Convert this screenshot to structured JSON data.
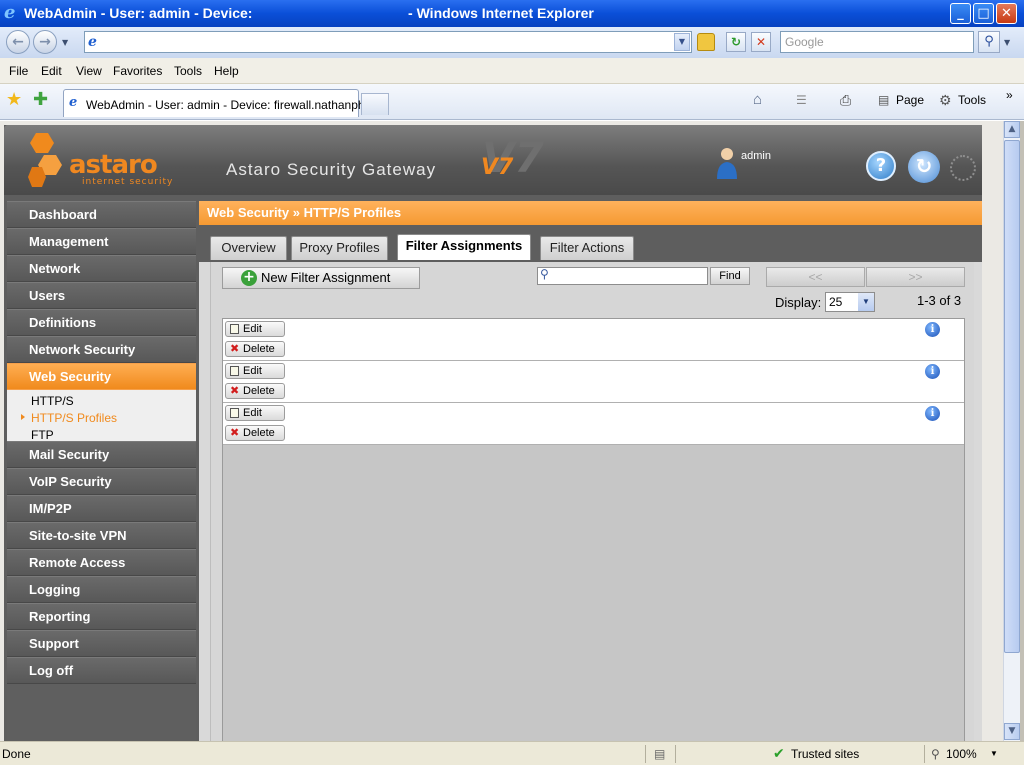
{
  "window": {
    "title": "WebAdmin - User: admin - Device:                                        - Windows Internet Explorer",
    "minimize": "_",
    "maximize": "□",
    "close": "✕"
  },
  "addressbar": {
    "url": "",
    "search_placeholder": "Google"
  },
  "menu": [
    "File",
    "Edit",
    "View",
    "Favorites",
    "Tools",
    "Help"
  ],
  "browser_tabs": {
    "active_tab": "WebAdmin - User: admin - Device: firewall.nathanpha...",
    "commands": {
      "page": "Page",
      "tools": "Tools"
    }
  },
  "header": {
    "logo_text": "astaro",
    "logo_sub": "internet security",
    "product": "Astaro Security Gateway",
    "version": "V7",
    "user": "admin"
  },
  "sidebar": {
    "items": [
      {
        "label": "Dashboard"
      },
      {
        "label": "Management"
      },
      {
        "label": "Network"
      },
      {
        "label": "Users"
      },
      {
        "label": "Definitions"
      },
      {
        "label": "Network Security"
      },
      {
        "label": "Web Security"
      },
      {
        "label": "Mail Security"
      },
      {
        "label": "VoIP Security"
      },
      {
        "label": "IM/P2P"
      },
      {
        "label": "Site-to-site VPN"
      },
      {
        "label": "Remote Access"
      },
      {
        "label": "Logging"
      },
      {
        "label": "Reporting"
      },
      {
        "label": "Support"
      },
      {
        "label": "Log off"
      }
    ],
    "active": "Web Security",
    "subitems": [
      "HTTP/S",
      "HTTP/S Profiles",
      "FTP"
    ],
    "active_subitem": "HTTP/S Profiles"
  },
  "main": {
    "breadcrumb": "Web Security » HTTP/S Profiles",
    "tabs": [
      "Overview",
      "Proxy Profiles",
      "Filter Assignments",
      "Filter Actions"
    ],
    "active_tab": "Filter Assignments",
    "new_button": "New Filter Assignment",
    "find_button": "Find",
    "find_value": "",
    "prev": "<<",
    "next": ">>",
    "display_label": "Display:",
    "display_value": "25",
    "count": "1-3 of 3",
    "rows": [
      {
        "edit": "Edit",
        "delete": "Delete"
      },
      {
        "edit": "Edit",
        "delete": "Delete"
      },
      {
        "edit": "Edit",
        "delete": "Delete"
      }
    ]
  },
  "statusbar": {
    "status": "Done",
    "zone": "Trusted sites",
    "zoom": "100%"
  },
  "colors": {
    "accent": "#f08a1d",
    "titlebar": "#0a4fd8",
    "sidebar_bg": "#5f5f5f"
  }
}
